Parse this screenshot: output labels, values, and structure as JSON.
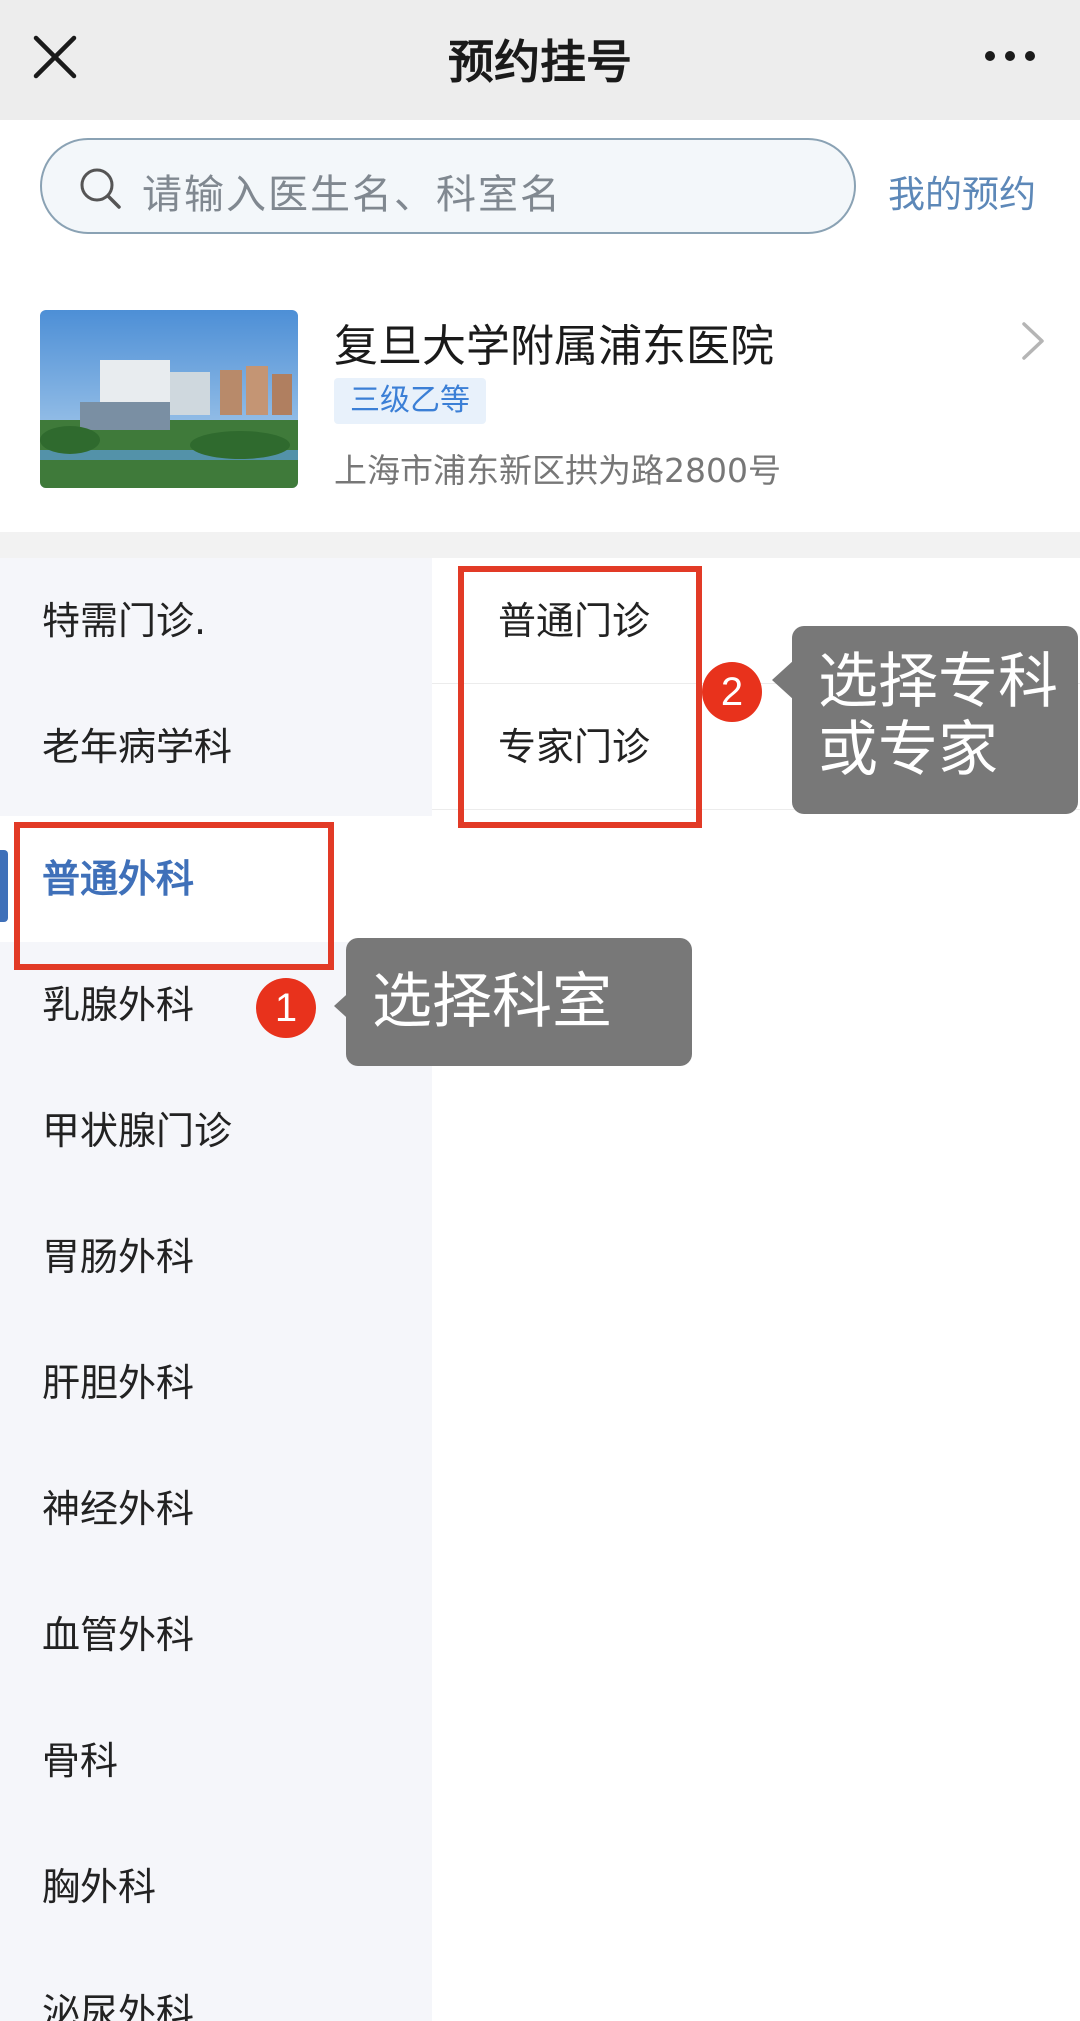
{
  "header": {
    "title": "预约挂号",
    "close_icon": "close-icon",
    "more_icon": "more-dots-icon"
  },
  "search": {
    "placeholder": "请输入医生名、科室名",
    "my_appointments": "我的预约"
  },
  "hospital": {
    "name": "复旦大学附属浦东医院",
    "grade": "三级乙等",
    "address": "上海市浦东新区拱为路2800号"
  },
  "departments": [
    {
      "label": "特需门诊."
    },
    {
      "label": "老年病学科"
    },
    {
      "label": "普通外科",
      "active": true
    },
    {
      "label": "乳腺外科"
    },
    {
      "label": "甲状腺门诊"
    },
    {
      "label": "胃肠外科"
    },
    {
      "label": "肝胆外科"
    },
    {
      "label": "神经外科"
    },
    {
      "label": "血管外科"
    },
    {
      "label": "骨科"
    },
    {
      "label": "胸外科"
    },
    {
      "label": "泌尿外科"
    }
  ],
  "clinics": [
    {
      "label": "普通门诊"
    },
    {
      "label": "专家门诊"
    }
  ],
  "annotations": {
    "step1_number": "1",
    "step1_text": "选择科室",
    "step2_number": "2",
    "step2_line1": "选择专科",
    "step2_line2": "或专家"
  },
  "colors": {
    "accent": "#3f70b9",
    "highlight_red": "#e23a26",
    "callout_gray": "#787878"
  }
}
